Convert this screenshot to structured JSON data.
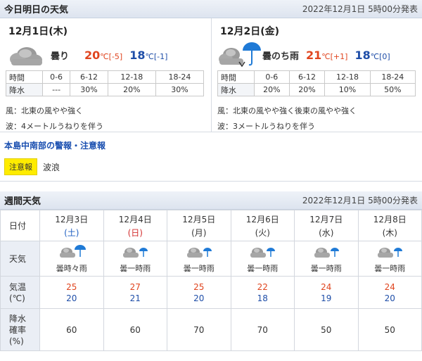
{
  "today": {
    "title": "今日明日の天気",
    "announce": "2022年12月1日 5時00分発表",
    "days": [
      {
        "date": "12月1日(木)",
        "icon": "cloud-icon",
        "condition": "曇り",
        "high": "20",
        "high_unit": "℃",
        "high_diff": "[-5]",
        "low": "18",
        "low_unit": "℃",
        "low_diff": "[-1]",
        "periods": [
          "0-6",
          "6-12",
          "12-18",
          "18-24"
        ],
        "time_label": "時間",
        "rain_label": "降水",
        "rain": [
          "---",
          "30%",
          "20%",
          "30%"
        ],
        "wind": "風：北東の風やや強く",
        "wave": "波：4メートルうねりを伴う"
      },
      {
        "date": "12月2日(金)",
        "icon": "cloud-then-rain-icon",
        "condition": "曇のち雨",
        "high": "21",
        "high_unit": "℃",
        "high_diff": "[+1]",
        "low": "18",
        "low_unit": "℃",
        "low_diff": "[0]",
        "periods": [
          "0-6",
          "6-12",
          "12-18",
          "18-24"
        ],
        "time_label": "時間",
        "rain_label": "降水",
        "rain": [
          "20%",
          "20%",
          "10%",
          "50%"
        ],
        "wind": "風：北東の風やや強く後東の風やや強く",
        "wave": "波：3メートルうねりを伴う"
      }
    ]
  },
  "warning": {
    "title": "本島中南部の警報・注意報",
    "badge": "注意報",
    "text": "波浪"
  },
  "weekly": {
    "title": "週間天気",
    "announce": "2022年12月1日 5時00分発表",
    "row_labels": {
      "date": "日付",
      "weather": "天気",
      "temp": "気温(℃)",
      "temp_line1": "気温",
      "temp_line2": "(℃)",
      "pop_line1": "降水",
      "pop_line2": "確率",
      "pop_line3": "(%)"
    },
    "days": [
      {
        "date": "12月3日",
        "dow": "(土)",
        "dow_type": "sat",
        "weather": "曇時々雨",
        "high": "25",
        "low": "20",
        "pop": "60"
      },
      {
        "date": "12月4日",
        "dow": "(日)",
        "dow_type": "sun",
        "weather": "曇一時雨",
        "high": "27",
        "low": "21",
        "pop": "60"
      },
      {
        "date": "12月5日",
        "dow": "(月)",
        "dow_type": "",
        "weather": "曇一時雨",
        "high": "25",
        "low": "20",
        "pop": "70"
      },
      {
        "date": "12月6日",
        "dow": "(火)",
        "dow_type": "",
        "weather": "曇一時雨",
        "high": "22",
        "low": "18",
        "pop": "70"
      },
      {
        "date": "12月7日",
        "dow": "(水)",
        "dow_type": "",
        "weather": "曇一時雨",
        "high": "24",
        "low": "19",
        "pop": "50"
      },
      {
        "date": "12月8日",
        "dow": "(木)",
        "dow_type": "",
        "weather": "曇一時雨",
        "high": "24",
        "low": "20",
        "pop": "50"
      }
    ]
  },
  "colors": {
    "high": "#e0451f",
    "low": "#1f4ea8",
    "badge": "#ffec00",
    "umbrella": "#1f7ad6"
  }
}
